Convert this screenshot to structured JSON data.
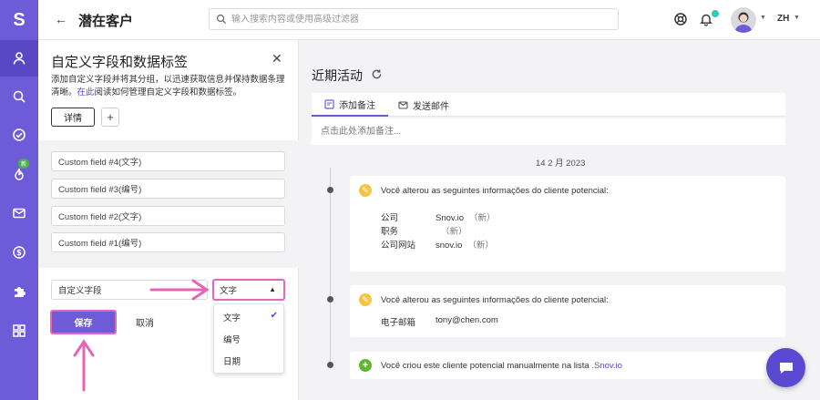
{
  "app": {
    "logo": "S"
  },
  "sidebar": {
    "items": [
      {
        "icon": "user-icon",
        "active": true
      },
      {
        "icon": "search-icon"
      },
      {
        "icon": "check-circle-icon"
      },
      {
        "icon": "flame-icon",
        "badge": "新"
      },
      {
        "icon": "mail-icon"
      },
      {
        "icon": "dollar-icon"
      },
      {
        "icon": "puzzle-icon"
      },
      {
        "icon": "apps-grid-icon"
      }
    ]
  },
  "header": {
    "title": "潜在客户",
    "search_placeholder": "输入搜索内容或使用高级过滤器",
    "language": "ZH"
  },
  "custom_fields_panel": {
    "title": "自定义字段和数据标签",
    "description": "添加自定义字段并将其分组，以迅速获取信息并保持数据条理清晰。",
    "link_text": "在此",
    "description_tail": "阅读如何管理自定义字段和数据标签。",
    "tab_label": "详情",
    "add_tab": "+",
    "fields": [
      "Custom field #4(文字)",
      "Custom field #3(编号)",
      "Custom field #2(文字)",
      "Custom field #1(编号)"
    ],
    "new_field_value": "自定义字段",
    "type_selected": "文字",
    "type_options": [
      "文字",
      "编号",
      "日期"
    ],
    "save_label": "保存",
    "cancel_label": "取消"
  },
  "activity": {
    "title": "近期活动",
    "tabs": [
      "添加备注",
      "发送邮件"
    ],
    "note_placeholder": "点击此处添加备注...",
    "date": "14 2 月 2023",
    "entries": [
      {
        "icon": "edit-icon",
        "color": "#f5c542",
        "text": "Você alterou as seguintes informações do cliente potencial:",
        "rows": [
          {
            "key": "公司",
            "value": "Snov.io",
            "tag": "（新）"
          },
          {
            "key": "职务",
            "value": "",
            "tag": "（新）"
          },
          {
            "key": "公司网站",
            "value": "snov.io",
            "tag": "（新）"
          }
        ]
      },
      {
        "icon": "edit-icon",
        "color": "#f5c542",
        "text": "Você alterou as seguintes informações do cliente potencial:",
        "rows": [
          {
            "key": "电子邮箱",
            "value": "tony@chen.com",
            "tag": ""
          }
        ]
      },
      {
        "icon": "plus-icon",
        "color": "#5fb832",
        "text": "Você criou este cliente potencial manualmente na lista ",
        "link": ".Snov.io"
      }
    ]
  },
  "colors": {
    "brand": "#6e5bd8",
    "highlight": "#e466b6"
  }
}
